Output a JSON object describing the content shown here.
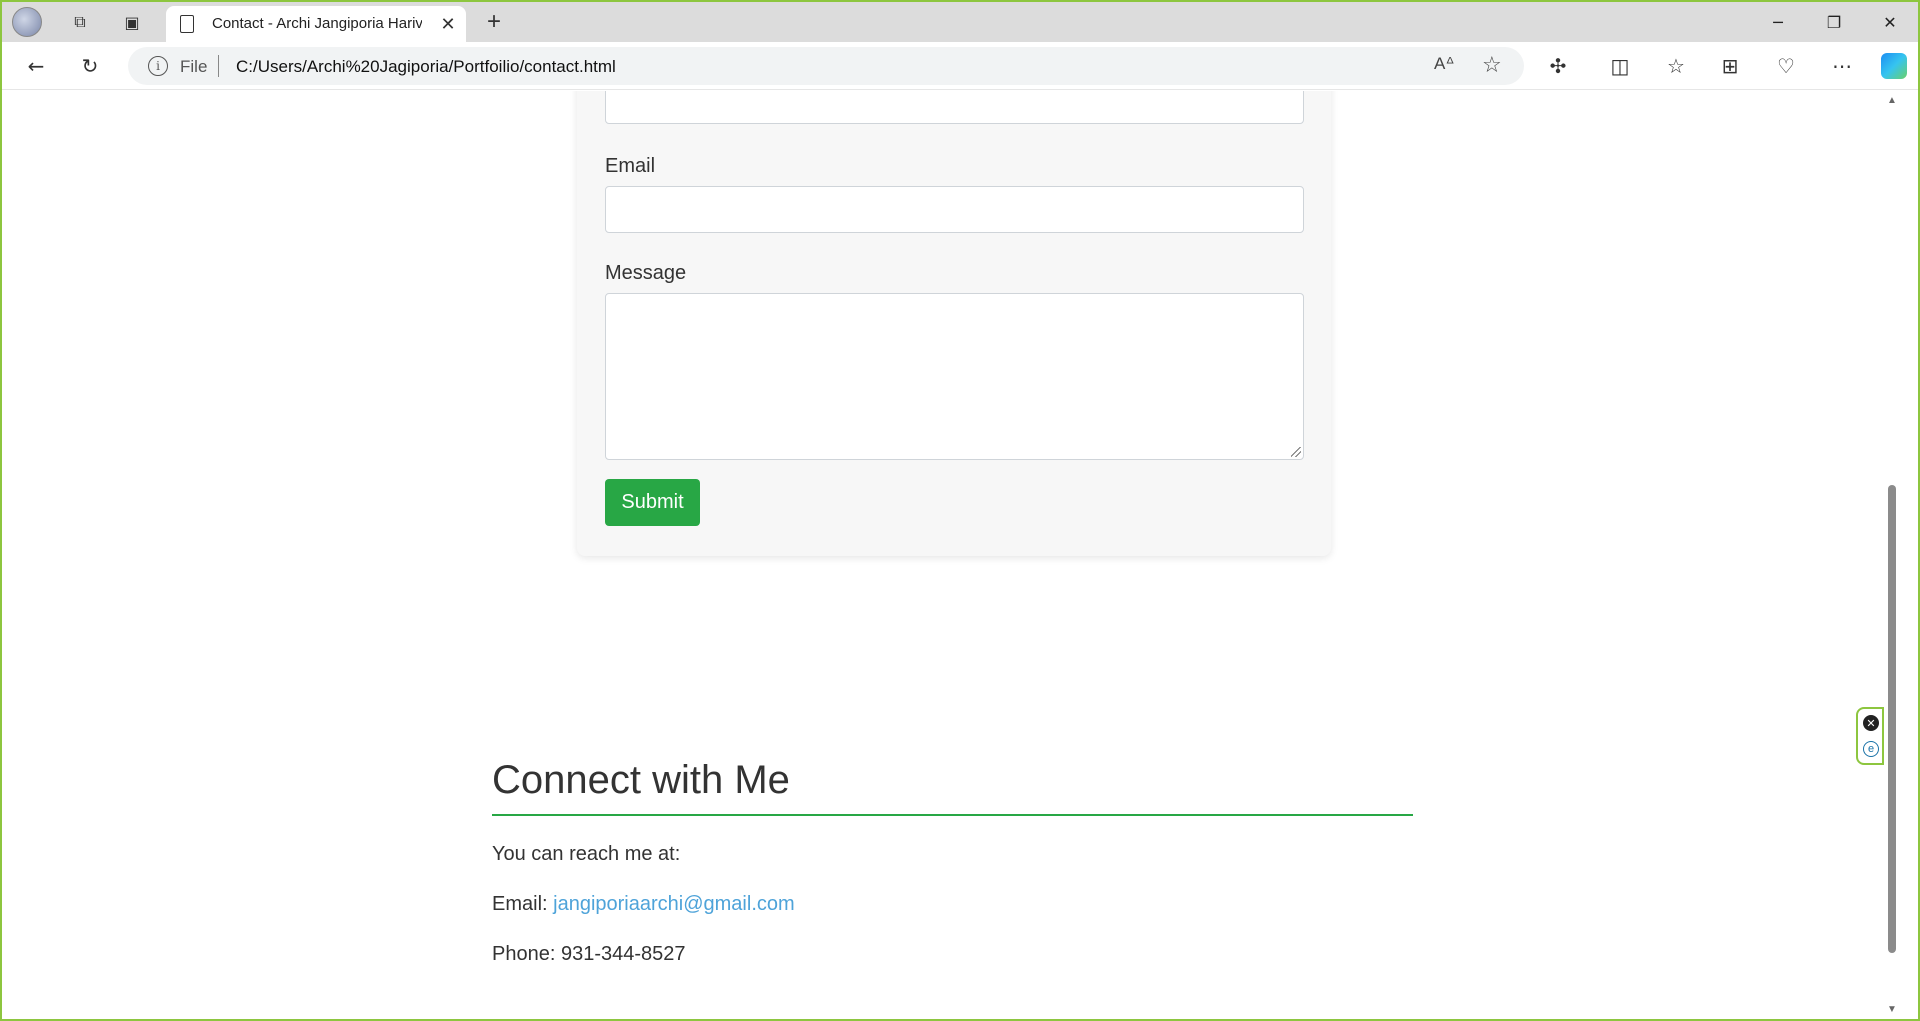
{
  "browser": {
    "tab_title": "Contact - Archi Jangiporia Hariva",
    "address_scheme_label": "File",
    "url": "C:/Users/Archi%20Jagiporia/Portfoilio/contact.html"
  },
  "form": {
    "email_label": "Email",
    "message_label": "Message",
    "submit_label": "Submit"
  },
  "connect": {
    "title": "Connect with Me",
    "intro": "You can reach me at:",
    "email_prefix": "Email:",
    "email": "jangiporiaarchi@gmail.com",
    "phone": "Phone: 931-344-8527"
  },
  "colors": {
    "accent": "#28a745",
    "link": "#4ea3d9",
    "window_border": "#8dc63f"
  },
  "icons": [
    "profile-avatar-icon",
    "workspaces-icon",
    "vertical-tabs-icon",
    "document-icon",
    "close-icon",
    "plus-icon",
    "minimize-icon",
    "restore-icon",
    "window-close-icon",
    "back-icon",
    "refresh-icon",
    "info-icon",
    "read-aloud-icon",
    "favorite-star-icon",
    "extensions-icon",
    "split-screen-icon",
    "favorites-icon",
    "collections-icon",
    "browser-essentials-icon",
    "more-icon",
    "copilot-icon"
  ]
}
